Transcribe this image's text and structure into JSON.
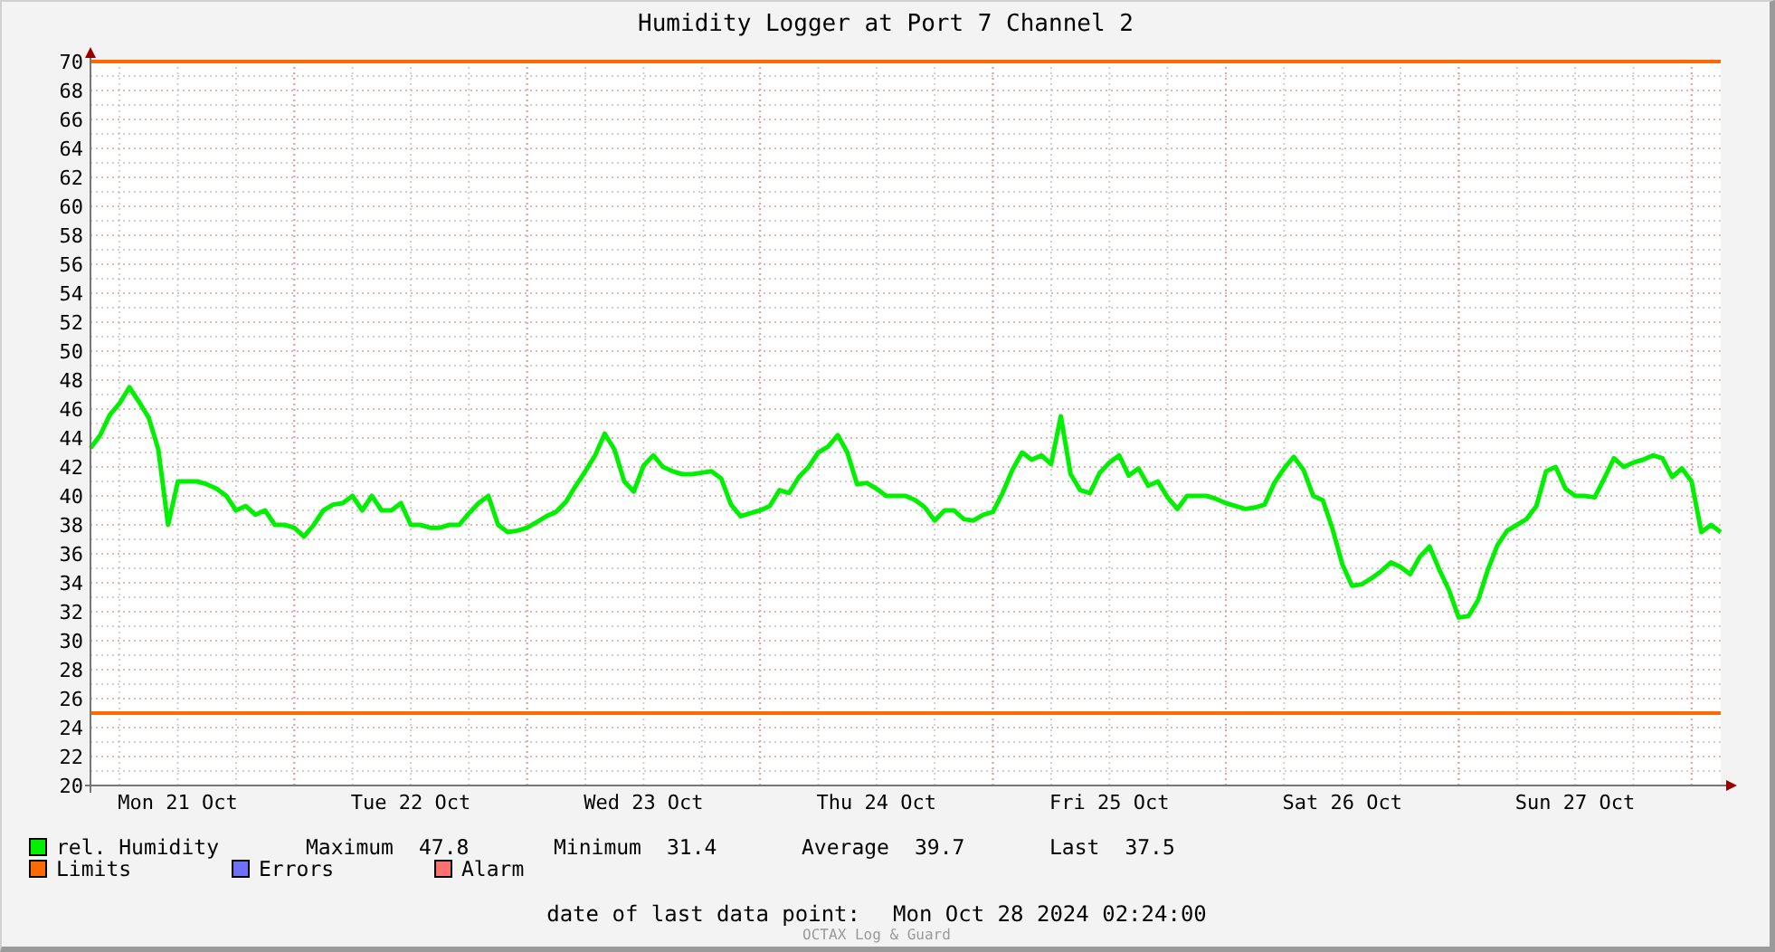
{
  "title": "Humidity Logger at Port 7 Channel 2",
  "chart_data": {
    "type": "line",
    "ylim": [
      20,
      70
    ],
    "yticks": [
      20,
      22,
      24,
      26,
      28,
      30,
      32,
      34,
      36,
      38,
      40,
      42,
      44,
      46,
      48,
      50,
      52,
      54,
      56,
      58,
      60,
      62,
      64,
      66,
      68,
      70
    ],
    "categories": [
      null,
      null,
      null,
      null,
      null,
      null,
      null,
      null,
      null,
      "Mon 21 Oct",
      null,
      null,
      null,
      null,
      null,
      null,
      null,
      null,
      null,
      null,
      null,
      null,
      null,
      null,
      null,
      null,
      null,
      null,
      null,
      null,
      null,
      null,
      null,
      "Tue 22 Oct",
      null,
      null,
      null,
      null,
      null,
      null,
      null,
      null,
      null,
      null,
      null,
      null,
      null,
      null,
      null,
      null,
      null,
      null,
      null,
      null,
      null,
      null,
      null,
      "Wed 23 Oct",
      null,
      null,
      null,
      null,
      null,
      null,
      null,
      null,
      null,
      null,
      null,
      null,
      null,
      null,
      null,
      null,
      null,
      null,
      null,
      null,
      null,
      null,
      null,
      "Thu 24 Oct",
      null,
      null,
      null,
      null,
      null,
      null,
      null,
      null,
      null,
      null,
      null,
      null,
      null,
      null,
      null,
      null,
      null,
      null,
      null,
      null,
      null,
      null,
      null,
      "Fri 25 Oct",
      null,
      null,
      null,
      null,
      null,
      null,
      null,
      null,
      null,
      null,
      null,
      null,
      null,
      null,
      null,
      null,
      null,
      null,
      null,
      null,
      null,
      null,
      null,
      "Sat 26 Oct",
      null,
      null,
      null,
      null,
      null,
      null,
      null,
      null,
      null,
      null,
      null,
      null,
      null,
      null,
      null,
      null,
      null,
      null,
      null,
      null,
      null,
      null,
      null,
      "Sun 27 Oct",
      null,
      null,
      null,
      null,
      null,
      null,
      null,
      null,
      null,
      null,
      null,
      null,
      null,
      null,
      null
    ],
    "series": [
      {
        "name": "rel. Humidity",
        "color": "#00f000",
        "values": [
          43.3,
          44.2,
          45.6,
          46.4,
          47.5,
          46.5,
          45.4,
          43.2,
          38,
          41,
          41,
          41,
          40.8,
          40.5,
          40,
          39,
          39.3,
          38.7,
          39,
          38,
          38,
          37.8,
          37.2,
          38,
          39,
          39.4,
          39.5,
          40,
          39,
          40,
          39,
          39,
          39.5,
          38,
          38,
          37.8,
          37.8,
          38,
          38,
          38.8,
          39.5,
          40,
          38,
          37.5,
          37.6,
          37.8,
          38.2,
          38.6,
          38.9,
          39.6,
          40.7,
          41.7,
          42.8,
          44.3,
          43.2,
          41,
          40.3,
          42.1,
          42.8,
          42,
          41.7,
          41.5,
          41.5,
          41.6,
          41.7,
          41.2,
          39.4,
          38.6,
          38.8,
          39,
          39.3,
          40.4,
          40.2,
          41.3,
          42,
          43,
          43.4,
          44.2,
          43,
          40.8,
          40.9,
          40.5,
          40,
          40,
          40,
          39.7,
          39.2,
          38.3,
          39,
          39,
          38.4,
          38.3,
          38.7,
          38.9,
          40.2,
          41.8,
          43,
          42.5,
          42.8,
          42.2,
          45.5,
          41.5,
          40.4,
          40.2,
          41.6,
          42.3,
          42.8,
          41.4,
          41.9,
          40.7,
          41,
          39.9,
          39.1,
          40,
          40,
          40,
          39.8,
          39.5,
          39.3,
          39.1,
          39.2,
          39.4,
          40.9,
          41.9,
          42.7,
          41.8,
          40,
          39.7,
          37.7,
          35.3,
          33.8,
          33.9,
          34.3,
          34.8,
          35.4,
          35.1,
          34.6,
          35.8,
          36.5,
          34.9,
          33.5,
          31.6,
          31.7,
          32.8,
          34.9,
          36.6,
          37.6,
          38,
          38.4,
          39.3,
          41.7,
          42,
          40.5,
          40,
          40,
          39.9,
          41.2,
          42.6,
          42,
          42.3,
          42.5,
          42.8,
          42.6,
          41.3,
          41.9,
          41,
          37.5,
          38,
          37.5
        ]
      },
      {
        "name": "Limits",
        "color": "#ff6a00",
        "values": [
          70,
          70,
          70,
          70,
          70,
          70,
          70,
          70,
          70,
          70,
          70,
          70,
          70,
          70,
          70,
          70,
          70,
          70,
          70,
          70,
          70,
          70,
          70,
          70,
          70,
          70,
          70,
          70,
          70,
          70,
          70,
          70,
          70,
          70,
          70,
          70,
          70,
          70,
          70,
          70,
          70,
          70,
          70,
          70,
          70,
          70,
          70,
          70,
          70,
          70,
          70,
          70,
          70,
          70,
          70,
          70,
          70,
          70,
          70,
          70,
          70,
          70,
          70,
          70,
          70,
          70,
          70,
          70,
          70,
          70,
          70,
          70,
          70,
          70,
          70,
          70,
          70,
          70,
          70,
          70,
          70,
          70,
          70,
          70,
          70,
          70,
          70,
          70,
          70,
          70,
          70,
          70,
          70,
          70,
          70,
          70,
          70,
          70,
          70,
          70,
          70,
          70,
          70,
          70,
          70,
          70,
          70,
          70,
          70,
          70,
          70,
          70,
          70,
          70,
          70,
          70,
          70,
          70,
          70,
          70,
          70,
          70,
          70,
          70,
          70,
          70,
          70,
          70,
          70,
          70,
          70,
          70,
          70,
          70,
          70,
          70,
          70,
          70,
          70,
          70,
          70,
          70,
          70,
          70,
          70,
          70,
          70,
          70,
          70,
          70,
          70,
          70,
          70,
          70,
          70,
          70,
          70,
          70,
          70,
          70,
          70,
          70,
          70,
          70,
          70,
          70,
          70,
          70,
          70
        ]
      },
      {
        "color": "#ff6a00",
        "values": [
          25,
          25,
          25,
          25,
          25,
          25,
          25,
          25,
          25,
          25,
          25,
          25,
          25,
          25,
          25,
          25,
          25,
          25,
          25,
          25,
          25,
          25,
          25,
          25,
          25,
          25,
          25,
          25,
          25,
          25,
          25,
          25,
          25,
          25,
          25,
          25,
          25,
          25,
          25,
          25,
          25,
          25,
          25,
          25,
          25,
          25,
          25,
          25,
          25,
          25,
          25,
          25,
          25,
          25,
          25,
          25,
          25,
          25,
          25,
          25,
          25,
          25,
          25,
          25,
          25,
          25,
          25,
          25,
          25,
          25,
          25,
          25,
          25,
          25,
          25,
          25,
          25,
          25,
          25,
          25,
          25,
          25,
          25,
          25,
          25,
          25,
          25,
          25,
          25,
          25,
          25,
          25,
          25,
          25,
          25,
          25,
          25,
          25,
          25,
          25,
          25,
          25,
          25,
          25,
          25,
          25,
          25,
          25,
          25,
          25,
          25,
          25,
          25,
          25,
          25,
          25,
          25,
          25,
          25,
          25,
          25,
          25,
          25,
          25,
          25,
          25,
          25,
          25,
          25,
          25,
          25,
          25,
          25,
          25,
          25,
          25,
          25,
          25,
          25,
          25,
          25,
          25,
          25,
          25,
          25,
          25,
          25,
          25,
          25,
          25,
          25,
          25,
          25,
          25,
          25,
          25,
          25,
          25,
          25,
          25,
          25,
          25,
          25,
          25,
          25,
          25,
          25,
          25,
          25
        ]
      }
    ],
    "grid": true
  },
  "legend": [
    {
      "stats": [
        {
          "label": "Maximum",
          "value": "47.8"
        },
        {
          "label": "Minimum",
          "value": "31.4"
        },
        {
          "label": "Average",
          "value": "39.7"
        },
        {
          "label": "Last",
          "value": "37.5"
        }
      ]
    },
    {
      "label": "Errors",
      "color": "#7070ff"
    },
    {
      "label": "Alarm",
      "color": "#ff7070"
    }
  ],
  "footer": {
    "label": "date of last data point:",
    "value": "Mon Oct 28 2024 02:24:00"
  },
  "credit": "OCTAX Log & Guard"
}
